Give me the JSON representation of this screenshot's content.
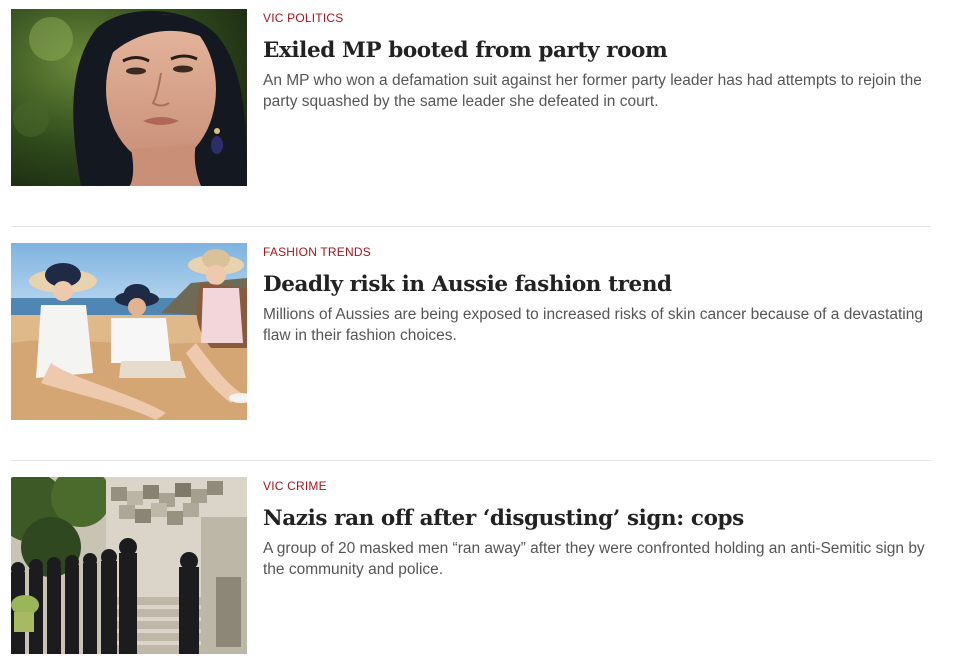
{
  "articles": [
    {
      "kicker": "VIC POLITICS",
      "headline": "Exiled MP booted from party room",
      "standfirst": "An MP who won a defamation suit against her former party leader has had attempts to rejoin the party squashed by the same leader she defeated in court.",
      "image": "portrait-photo"
    },
    {
      "kicker": "FASHION TRENDS",
      "headline": "Deadly risk in Aussie fashion trend",
      "standfirst": "Millions of Aussies are being exposed to increased risks of skin cancer because of a devastating flaw in their fashion choices.",
      "image": "beach-hats-photo"
    },
    {
      "kicker": "VIC CRIME",
      "headline": "Nazis ran off after ‘disgusting’ sign: cops",
      "standfirst": "A group of 20 masked men “ran away” after they were confronted holding an anti-Semitic sign by the community and police.",
      "image": "masked-group-photo"
    }
  ],
  "colors": {
    "kicker": "#a3161c",
    "headline": "#222222",
    "standfirst": "#555555",
    "divider": "#e4e4e4"
  }
}
